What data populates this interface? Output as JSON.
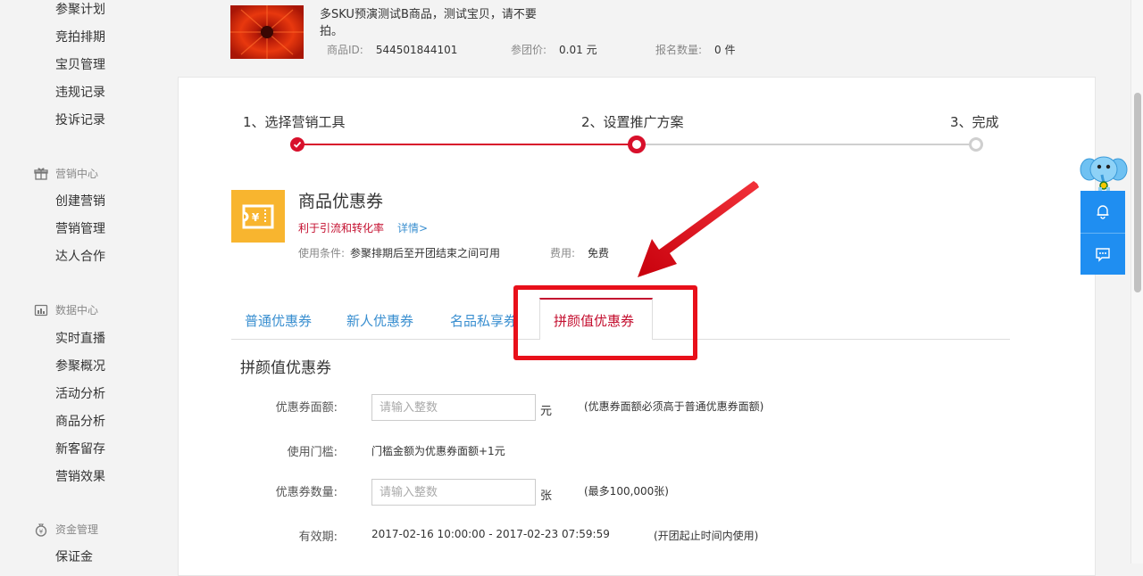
{
  "sidebar": {
    "items_top": [
      "参聚计划",
      "竞拍排期",
      "宝贝管理",
      "违规记录",
      "投诉记录"
    ],
    "group_marketing": "营销中心",
    "items_marketing": [
      "创建营销",
      "营销管理",
      "达人合作"
    ],
    "group_data": "数据中心",
    "items_data": [
      "实时直播",
      "参聚概况",
      "活动分析",
      "商品分析",
      "新客留存",
      "营销效果"
    ],
    "group_finance": "资金管理",
    "items_finance": [
      "保证金"
    ]
  },
  "product": {
    "title": "多SKU预演测试B商品，测试宝贝，请不要拍。",
    "id_label": "商品ID:",
    "id_value": "544501844101",
    "price_label": "参团价:",
    "price_value": "0.01 元",
    "count_label": "报名数量:",
    "count_value": "0 件"
  },
  "steps": [
    {
      "label": "1、选择营销工具",
      "state": "done"
    },
    {
      "label": "2、设置推广方案",
      "state": "current"
    },
    {
      "label": "3、完成",
      "state": "todo"
    }
  ],
  "tool": {
    "title": "商品优惠券",
    "description": "利于引流和转化率",
    "detail_link": "详情>",
    "condition_label": "使用条件:",
    "condition_value": "参聚排期后至开团结束之间可用",
    "fee_label": "费用:",
    "fee_value": "免费"
  },
  "tabs": {
    "items": [
      "普通优惠券",
      "新人优惠券",
      "名品私享券",
      "拼颜值优惠券"
    ],
    "active_index": 3
  },
  "form": {
    "section_title": "拼颜值优惠券",
    "amount_label": "优惠券面额:",
    "amount_placeholder": "请输入整数",
    "amount_unit": "元",
    "amount_note": "(优惠券面额必须高于普通优惠券面额)",
    "threshold_label": "使用门槛:",
    "threshold_value": "门槛金额为优惠券面额+1元",
    "quantity_label": "优惠券数量:",
    "quantity_placeholder": "请输入整数",
    "quantity_unit": "张",
    "quantity_note": "(最多100,000张)",
    "validity_label": "有效期:",
    "validity_value": "2017-02-16 10:00:00 - 2017-02-23 07:59:59",
    "validity_note": "(开团起止时间内使用)"
  },
  "colors": {
    "accent_red": "#c40f2f",
    "link_blue": "#3a8fd0",
    "annotation_red": "#e8101a",
    "float_blue": "#1f8ef1",
    "coupon_yellow": "#f8b52f"
  },
  "icons": {
    "marketing": "gift-icon",
    "data": "chart-icon",
    "finance": "money-bag-icon",
    "float_top": "bell-icon",
    "float_bottom": "chat-icon",
    "mascot": "elephant-mascot-icon"
  }
}
